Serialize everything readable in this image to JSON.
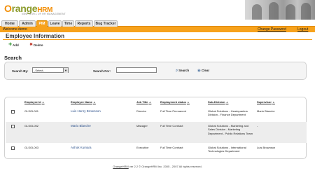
{
  "app": {
    "logo_letter": "O",
    "logo_rest": "range",
    "logo_hrm": "HRM",
    "tagline": "NEW LEVEL OF HR MANAGEMENT"
  },
  "nav": {
    "tabs": [
      {
        "label": "Home"
      },
      {
        "label": "Admin"
      },
      {
        "label": "PIM"
      },
      {
        "label": "Leave"
      },
      {
        "label": "Time"
      },
      {
        "label": "Reports"
      },
      {
        "label": "Bug Tracker"
      }
    ]
  },
  "welcome": {
    "text": "Welcome demo",
    "change_password": "Change Password",
    "logout": "Logout"
  },
  "page": {
    "title": "Employee Information",
    "add_label": "Add",
    "delete_label": "Delete"
  },
  "search": {
    "title": "Search",
    "search_by_label": "Search By:",
    "search_by_value": "-Select-",
    "search_for_label": "Search For:",
    "search_for_value": "",
    "search_button": "Search",
    "clear_button": "Clear"
  },
  "table": {
    "headers": {
      "id": "Employee Id",
      "name": "Employee Name",
      "job": "Job Title",
      "status": "Employment status",
      "subdiv": "Sub-Division",
      "supervisor": "Supervisor"
    },
    "rows": [
      {
        "id": "GLSOL001",
        "name": "Luis Henry Brownson",
        "job": "Director",
        "status": "Full Time Permanent",
        "subdiv": "Global Solutions - Headquarters Division - Finance Department",
        "supervisor": "Mario Blanche"
      },
      {
        "id": "GLSOL002",
        "name": "Mario Blanche",
        "job": "Manager",
        "status": "Full Time Contract",
        "subdiv": "Global Solutions - Marketing and Sales Division - Marketing Department - Public Relations Team",
        "supervisor": "-"
      },
      {
        "id": "GLSOL003",
        "name": "Ashok Kumara",
        "job": "Executive",
        "status": "Full Time Contract",
        "subdiv": "Global Solutions - International Technologies Department",
        "supervisor": "Luis Brownson"
      }
    ]
  },
  "footer": {
    "brand": "OrangeHRM",
    "text": " ver 2.2 © OrangeHRM Inc. 2005 - 2007 All rights reserved."
  }
}
